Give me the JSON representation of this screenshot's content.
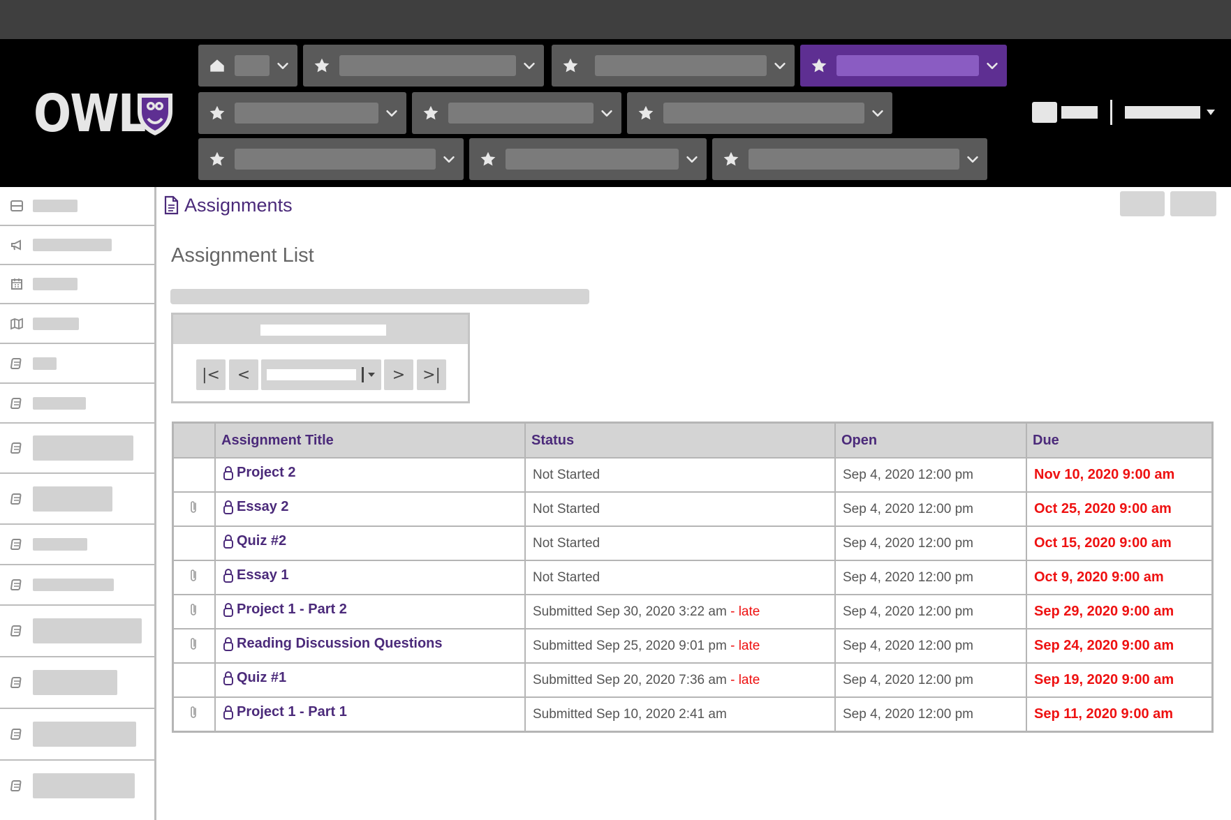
{
  "app": {
    "logo_text": "OWL"
  },
  "page": {
    "tool_title": "Assignments",
    "heading": "Assignment List"
  },
  "pager": {
    "first": "|<",
    "prev": "<",
    "next": ">",
    "last": ">|"
  },
  "table": {
    "headers": {
      "title": "Assignment Title",
      "status": "Status",
      "open": "Open",
      "due": "Due"
    },
    "rows": [
      {
        "attachment": false,
        "title": "Project 2",
        "status": "Not Started",
        "status_late": "",
        "open": "Sep 4, 2020 12:00 pm",
        "due": "Nov 10, 2020 9:00 am"
      },
      {
        "attachment": true,
        "title": "Essay 2",
        "status": "Not Started",
        "status_late": "",
        "open": "Sep 4, 2020 12:00 pm",
        "due": "Oct 25, 2020 9:00 am"
      },
      {
        "attachment": false,
        "title": "Quiz #2",
        "status": "Not Started",
        "status_late": "",
        "open": "Sep 4, 2020 12:00 pm",
        "due": "Oct 15, 2020 9:00 am"
      },
      {
        "attachment": true,
        "title": "Essay 1",
        "status": "Not Started",
        "status_late": "",
        "open": "Sep 4, 2020 12:00 pm",
        "due": "Oct 9, 2020 9:00 am"
      },
      {
        "attachment": true,
        "title": "Project 1 - Part 2",
        "status": "Submitted Sep 30, 2020 3:22 am",
        "status_late": " - late",
        "open": "Sep 4, 2020 12:00 pm",
        "due": "Sep 29, 2020 9:00 am"
      },
      {
        "attachment": true,
        "title": "Reading Discussion Questions",
        "status": "Submitted Sep 25, 2020 9:01 pm",
        "status_late": " - late",
        "open": "Sep 4, 2020 12:00 pm",
        "due": "Sep 24, 2020 9:00 am"
      },
      {
        "attachment": false,
        "title": "Quiz #1",
        "status": "Submitted Sep 20, 2020 7:36 am",
        "status_late": " - late",
        "open": "Sep 4, 2020 12:00 pm",
        "due": "Sep 19, 2020 9:00 am"
      },
      {
        "attachment": true,
        "title": "Project 1 - Part 1",
        "status": "Submitted Sep 10, 2020 2:41 am",
        "status_late": "",
        "open": "Sep 4, 2020 12:00 pm",
        "due": "Sep 11, 2020 9:00 am"
      }
    ]
  },
  "colors": {
    "brand_purple": "#5e2f92",
    "link_purple": "#4b2a7a",
    "due_red": "#ee1111",
    "navbar_bg": "#000000",
    "tab_gray": "#5a5a5a"
  },
  "icons": {
    "home": "home-icon",
    "favorite": "star-icon",
    "dropdown": "chevron-down-icon",
    "lock": "lock-icon",
    "attachment": "paperclip-icon",
    "tool": "document-icon"
  }
}
